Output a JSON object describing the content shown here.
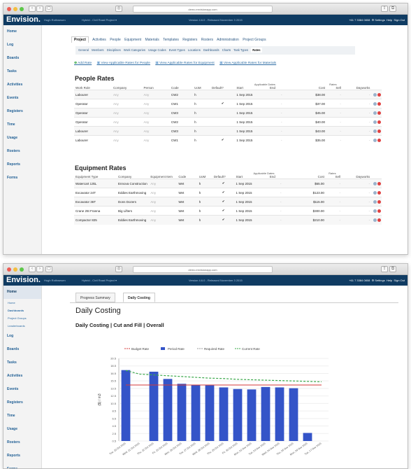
{
  "window1": {
    "url": "demo.envisionapp.com"
  },
  "window2": {
    "url": "demo.envisionapp.com"
  },
  "appbar": {
    "logo": "Envision.",
    "user": "Hugh Rothwesen",
    "project": "Hybrid - Civil Road Project ▾",
    "version": "Version 4.6.0 - Released November 3 2015",
    "phone": "+61 7 3384 0808",
    "settings": "⚙ Settings",
    "help": "Help",
    "signout": "Sign Out"
  },
  "sidebar1": [
    "Home",
    "Log",
    "Boards",
    "Tasks",
    "Activities",
    "Events",
    "Registers",
    "Time",
    "Usage",
    "Rosters",
    "Reports",
    "Forms"
  ],
  "sidebar2": {
    "home": "Home",
    "subs": [
      "Home",
      "Dashboards",
      "Project Groups",
      "Leaderboards"
    ],
    "items": [
      "Log",
      "Boards",
      "Tasks",
      "Activities",
      "Events",
      "Registers",
      "Time",
      "Usage",
      "Rosters",
      "Reports",
      "Forms"
    ]
  },
  "tabs": [
    "Project",
    "Activities",
    "People",
    "Equipment",
    "Materials",
    "Templates",
    "Registers",
    "Rosters",
    "Administration",
    "Project Groups"
  ],
  "subtabs": [
    "General",
    "Members",
    "Disciplines",
    "Work Categories",
    "Usage Codes",
    "Event Types",
    "Locations",
    "Dashboards",
    "Charts",
    "Task Types",
    "Rates"
  ],
  "links": {
    "add": "Add Rate",
    "people": "View Applicable Rates for People",
    "equipment": "View Applicable Rates for Equipment",
    "materials": "View Applicable Rates for Materials"
  },
  "people": {
    "title": "People Rates",
    "grp_dates": "Applicable Dates",
    "grp_rates": "Rates",
    "headers": [
      "Work Role",
      "Company",
      "Person",
      "Code",
      "UoM",
      "Default?",
      "Start",
      "End",
      "Cost",
      "Sell",
      "Dayworks"
    ],
    "rows": [
      [
        "Labourer",
        "Any",
        "Any",
        "CW2",
        "h",
        "",
        "1 Sep 2015",
        "-",
        "$38.00",
        "-",
        "-"
      ],
      [
        "Operator",
        "Any",
        "Any",
        "CW1",
        "h",
        "✔",
        "1 Sep 2015",
        "-",
        "$37.00",
        "-",
        "-"
      ],
      [
        "Operator",
        "Any",
        "Any",
        "CW3",
        "h",
        "",
        "1 Sep 2015",
        "-",
        "$45.00",
        "-",
        "-"
      ],
      [
        "Operator",
        "Any",
        "Any",
        "CW2",
        "h",
        "",
        "1 Sep 2015",
        "-",
        "$40.00",
        "-",
        "-"
      ],
      [
        "Labourer",
        "Any",
        "Any",
        "CW3",
        "h",
        "",
        "1 Sep 2015",
        "-",
        "$43.00",
        "-",
        "-"
      ],
      [
        "Labourer",
        "Any",
        "Any",
        "CW1",
        "h",
        "✔",
        "1 Sep 2015",
        "-",
        "$35.00",
        "-",
        "-"
      ]
    ]
  },
  "equipment": {
    "title": "Equipment Rates",
    "grp_dates": "Applicable Dates",
    "grp_rates": "Rates",
    "headers": [
      "Equipment Type",
      "Company",
      "Equipment Item",
      "Code",
      "UoM",
      "Default?",
      "Start",
      "End",
      "Cost",
      "Sell",
      "Dayworks"
    ],
    "rows": [
      [
        "Watercart 13kL",
        "Ennova Construction",
        "Any",
        "Wet",
        "h",
        "✔",
        "1 Sep 2015",
        "-",
        "$65.00",
        "-",
        "-"
      ],
      [
        "Excavator 24T",
        "Eddies Earthmoving",
        "Any",
        "Wet",
        "h",
        "✔",
        "1 Sep 2015",
        "-",
        "$123.00",
        "-",
        "-"
      ],
      [
        "Excavator 36T",
        "Dons Dozers",
        "Any",
        "Wet",
        "h",
        "✔",
        "1 Sep 2015",
        "-",
        "$115.00",
        "-",
        "-"
      ],
      [
        "Crane 25t Franna",
        "Big Lifters",
        "Any",
        "Wet",
        "h",
        "✔",
        "1 Sep 2015",
        "-",
        "$300.00",
        "-",
        "-"
      ],
      [
        "Compactor 825",
        "Eddies Earthmoving",
        "Any",
        "Wet",
        "h",
        "✔",
        "1 Sep 2015",
        "-",
        "$210.00",
        "-",
        "-"
      ]
    ]
  },
  "daily": {
    "tabs": [
      "Progress Summary",
      "Daily Costing"
    ],
    "title": "Daily Costing",
    "subtitle": "Daily Costing | Cut and Fill | Overall"
  },
  "chart_data": {
    "type": "bar",
    "legend": [
      "Budget Rate",
      "Period Rate",
      "Required Rate",
      "Current Rate"
    ],
    "ylabel": "($) / m3",
    "ylim": [
      0,
      20.5
    ],
    "yticks": [
      "20.5",
      "18.5",
      "16.5",
      "15.5",
      "13.5",
      "12.5",
      "10.5",
      "8.5",
      "6.5",
      "4.5",
      "2.5",
      "0.5"
    ],
    "categories": [
      "Tue, 20 Oct 2015",
      "Wed, 21 Oct 2015",
      "Thu, 22 Oct 2015",
      "Fri, 23 Oct 2015",
      "Mon, 26 Oct 2015",
      "Tue, 27 Oct 2015",
      "Wed, 28 Oct 2015",
      "Thu, 29 Oct 2015",
      "Fri, 30 Oct 2015",
      "Mon, 02 Nov 2015",
      "Tue, 03 Nov 2015",
      "Wed, 04 Nov 2015",
      "Thu, 05 Nov 2015",
      "Mon, 09 Nov 2015",
      "Tue, 17 Nov 2015"
    ],
    "series": [
      {
        "name": "Period Rate",
        "type": "bar",
        "color": "#3454c8",
        "values": [
          17.6,
          0,
          17.2,
          15.4,
          14.2,
          13.9,
          13.8,
          13.3,
          12.9,
          12.8,
          13.4,
          13.3,
          13.1,
          2.0,
          0
        ]
      },
      {
        "name": "Budget Rate",
        "type": "line",
        "color": "#d43a3a",
        "values": [
          13.9,
          13.9,
          13.9,
          13.9,
          13.9,
          13.9,
          13.9,
          13.9,
          13.9,
          13.9,
          13.9,
          13.9,
          13.9,
          13.9,
          13.9
        ]
      },
      {
        "name": "Current Rate",
        "type": "line",
        "color": "#3aa84a",
        "values": [
          17.5,
          16.6,
          16.4,
          16.2,
          16.0,
          15.8,
          15.6,
          15.5,
          15.3,
          15.2,
          15.1,
          15.0,
          14.9,
          14.8,
          14.7
        ]
      }
    ]
  }
}
